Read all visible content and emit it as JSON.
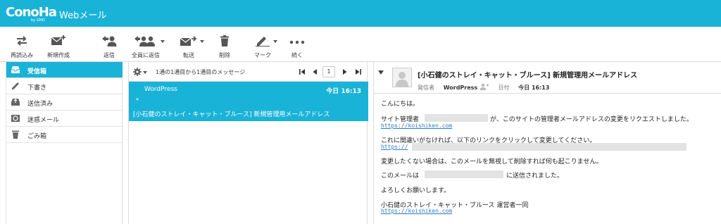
{
  "header": {
    "logo_text": "ConoHa",
    "logo_sub": "by GMO",
    "app_title": "Webメール",
    "bg_color": "#1ab3d8"
  },
  "toolbar": {
    "reload": "再読込み",
    "compose": "新規作成",
    "reply": "返信",
    "reply_all": "全員に返信",
    "forward": "転送",
    "delete": "削除",
    "mark": "マーク",
    "more": "続く"
  },
  "sidebar": {
    "items": [
      {
        "label": "受信箱",
        "icon": "inbox-icon"
      },
      {
        "label": "下書き",
        "icon": "pencil-icon"
      },
      {
        "label": "送信済み",
        "icon": "sent-icon"
      },
      {
        "label": "迷惑メール",
        "icon": "junk-icon"
      },
      {
        "label": "ごみ箱",
        "icon": "trash-icon"
      }
    ]
  },
  "list": {
    "count_text": "1通の1通目から1通目のメッセージ",
    "page": "1",
    "message": {
      "from": "WordPress",
      "date": "今日 16:13",
      "flag": "*",
      "subject": "[小石健のストレイ・キャット・ブルース] 新規管理用メールアドレス"
    }
  },
  "reader": {
    "subject": "[小石健のストレイ・キャット・ブルース] 新規管理用メールアドレス",
    "from_label": "発信者",
    "from": "WordPress",
    "date_label": "日付",
    "date": "今日 16:13",
    "body": {
      "greeting": "こんにちは。",
      "line1_a": "サイト管理者",
      "line1_b": "が、このサイトの管理者メールアドレスの変更をリクエストしました。",
      "link1": "https://koishiken.com",
      "line2": "これに間違いがなければ、以下のリンクをクリックして変更してください。",
      "link2": "https://",
      "line3": "変更したくない場合は、このメールを無視して削除すれば何も起こりません。",
      "line4_a": "このメールは",
      "line4_b": "に送信されました。",
      "line5": "よろしくお願いします。",
      "signature": "小石健のストレイ・キャット・ブルース 運営者一同",
      "link3": "https://koishiken.com"
    }
  }
}
